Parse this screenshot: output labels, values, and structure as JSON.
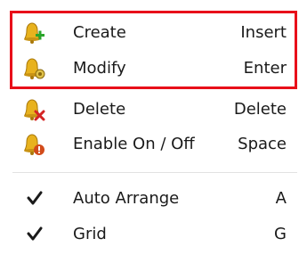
{
  "menu": {
    "items": [
      {
        "label": "Create",
        "shortcut": "Insert",
        "icon": "bell-add-icon"
      },
      {
        "label": "Modify",
        "shortcut": "Enter",
        "icon": "bell-modify-icon"
      },
      {
        "label": "Delete",
        "shortcut": "Delete",
        "icon": "bell-delete-icon"
      },
      {
        "label": "Enable On / Off",
        "shortcut": "Space",
        "icon": "bell-disable-icon"
      }
    ],
    "toggles": [
      {
        "label": "Auto Arrange",
        "shortcut": "A",
        "checked": true
      },
      {
        "label": "Grid",
        "shortcut": "G",
        "checked": true
      }
    ]
  },
  "colors": {
    "highlight_border": "#e8101a",
    "bell": "#e8b21e",
    "plus": "#2aa52a",
    "delete_x": "#d42424",
    "disable_badge": "#d24b1a"
  }
}
